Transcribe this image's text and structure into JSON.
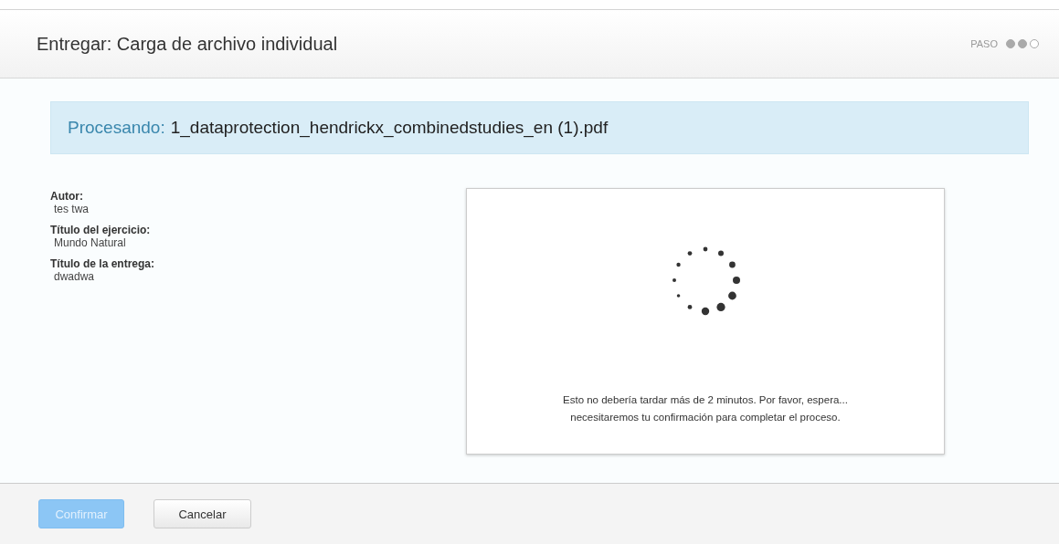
{
  "header": {
    "title": "Entregar: Carga de archivo individual",
    "step_label": "PASO",
    "steps": [
      {
        "done": true
      },
      {
        "done": true
      },
      {
        "done": false
      }
    ]
  },
  "banner": {
    "label": "Procesando:",
    "filename": "1_dataprotection_hendrickx_combinedstudies_en (1).pdf"
  },
  "details": [
    {
      "label": "Autor:",
      "value": "tes twa"
    },
    {
      "label": "Título del ejercicio:",
      "value": "Mundo Natural"
    },
    {
      "label": "Título de la entrega:",
      "value": "dwadwa"
    }
  ],
  "progress": {
    "message_lines": [
      "Esto no debería tardar más de 2 minutos. Por favor, espera...",
      "necesitaremos tu confirmación para completar el proceso."
    ]
  },
  "buttons": [
    {
      "label": "Confirmar",
      "kind": "primary",
      "disabled": true
    },
    {
      "label": "Cancelar",
      "kind": "secondary",
      "disabled": false
    }
  ]
}
